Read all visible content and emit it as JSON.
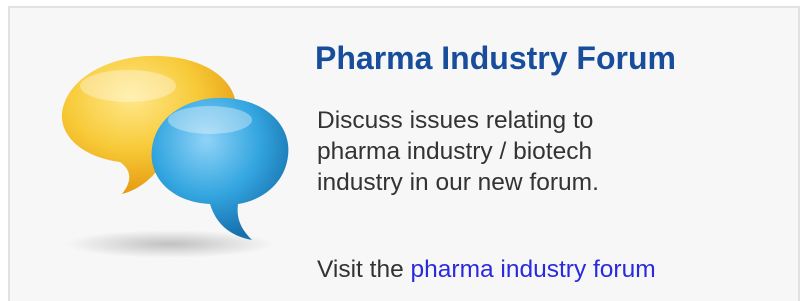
{
  "forum": {
    "title": "Pharma Industry Forum",
    "description_lines": [
      "Discuss issues relating to",
      "pharma industry / biotech",
      "industry in our new forum."
    ],
    "visit_prefix": "Visit the",
    "visit_link": "pharma industry forum"
  },
  "icon": "chat-bubbles-icon",
  "colors": {
    "title": "#174d9b",
    "body_text": "#333333",
    "link": "#2a2add",
    "card_background": "#f7f7f7",
    "card_border": "#e2e2e2",
    "bubble_yellow": "#f5c22a",
    "bubble_blue": "#2a9ad6"
  }
}
